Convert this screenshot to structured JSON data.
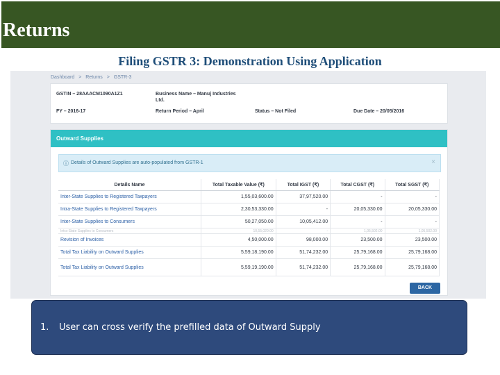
{
  "header": {
    "title": "Returns",
    "subtitle": "Filing GSTR 3: Demonstration Using Application"
  },
  "breadcrumb": [
    "Dashboard",
    ">",
    "Returns",
    ">",
    "GSTR-3"
  ],
  "info": {
    "gstin": "GSTIN – 28AAACM1090A1Z1",
    "business_name": "Business Name – Manuj Industries Ltd.",
    "fy": "FY – 2016-17",
    "return_period": "Return Period – April",
    "status": "Status – Not Filed",
    "due_date": "Due Date – 20/05/2016"
  },
  "section": {
    "title": "Outward Supplies",
    "alert_icon": "info-circle-icon",
    "alert": "Details of Outward Supplies are auto-populated from GSTR-1",
    "close_icon": "close-icon",
    "close_glyph": "×"
  },
  "table": {
    "headers": [
      "Details Name",
      "Total Taxable Value (₹)",
      "Total IGST (₹)",
      "Total CGST (₹)",
      "Total SGST (₹)"
    ],
    "rows": [
      [
        "Inter-State Supplies to Registered Taxpayers",
        "1,55,03,600.00",
        "37,97,520.00",
        "-",
        "-"
      ],
      [
        "Intra-State Supplies to Registered Taxpayers",
        "2,30,53,330.00",
        "-",
        "20,05,330.00",
        "20,05,330.00"
      ],
      [
        "Inter-State Supplies to Consumers",
        "50,27,050.00",
        "10,05,412.00",
        "-",
        "-"
      ],
      [
        "Intra-State Supplies to Consumers",
        "10,55,020.00",
        "-",
        "1,05,502.00",
        "1,05,502.00"
      ],
      [
        "Revision of Invoices",
        "4,50,000.00",
        "98,000.00",
        "23,500.00",
        "23,500.00"
      ],
      [
        "Total Tax Liability on Outward Supplies",
        "5,59,18,190.00",
        "51,74,232.00",
        "25,79,168.00",
        "25,79,168.00"
      ],
      [
        "Total Tax Liability on Outward Supplies",
        "5,59,19,190.00",
        "51,74,232.00",
        "25,79,168.00",
        "25,79,168.00"
      ]
    ]
  },
  "back_button": "BACK",
  "note": {
    "number": "1.",
    "text": "User can cross verify the prefilled data of Outward Supply"
  },
  "colors": {
    "title_bar": "#375623",
    "section_header": "#2fc0c4",
    "note_box": "#2e4a7c",
    "button": "#2c66a3",
    "link": "#2b5fa6"
  }
}
